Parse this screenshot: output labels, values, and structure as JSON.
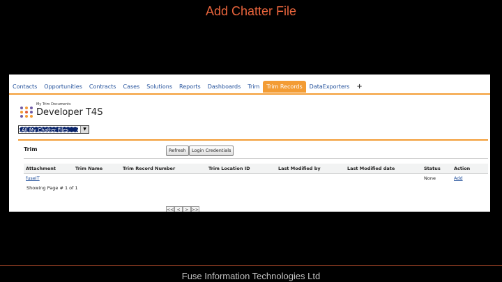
{
  "slide": {
    "title": "Add Chatter File",
    "footer": "Fuse Information Technologies Ltd"
  },
  "nav": {
    "tabs": [
      {
        "label": "Contacts",
        "active": false
      },
      {
        "label": "Opportunities",
        "active": false
      },
      {
        "label": "Contracts",
        "active": false
      },
      {
        "label": "Cases",
        "active": false
      },
      {
        "label": "Solutions",
        "active": false
      },
      {
        "label": "Reports",
        "active": false
      },
      {
        "label": "Dashboards",
        "active": false
      },
      {
        "label": "Trim",
        "active": false
      },
      {
        "label": "Trim Records",
        "active": true
      },
      {
        "label": "DataExporters",
        "active": false
      }
    ],
    "add_tab": "+"
  },
  "app": {
    "subtitle": "My Trim Documents",
    "title": "Developer T4S",
    "logo_colors": [
      "#6f5aa6",
      "#f39c34",
      "#6f5aa6",
      "#f39c34",
      "#e05c3c",
      "#6f5aa6"
    ]
  },
  "filter": {
    "selected": "All My Chatter Files",
    "arrow": "▼"
  },
  "panel": {
    "title": "Trim",
    "refresh_label": "Refresh",
    "login_label": "Login Credentials"
  },
  "table": {
    "headers": [
      "Attachment",
      "Trim Name",
      "Trim Record Number",
      "Trim Location ID",
      "Last Modified by",
      "Last Modified date",
      "Status",
      "Action"
    ],
    "row": {
      "attachment": "fuseIT",
      "status": "None",
      "action": "Add"
    },
    "paging": "Showing Page # 1 of 1"
  },
  "pager": {
    "first": "<<",
    "prev": "<",
    "next": ">",
    "last": ">>"
  },
  "colors": {
    "accent": "#f39c34",
    "link": "#1f4e9a",
    "title": "#e8643c"
  }
}
